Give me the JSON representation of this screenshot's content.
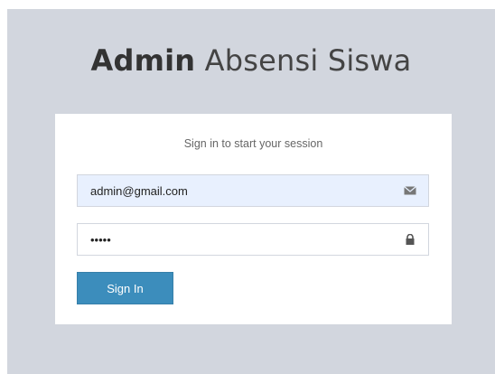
{
  "logo": {
    "bold": "Admin",
    "light": "Absensi Siswa"
  },
  "login": {
    "message": "Sign in to start your session",
    "email": {
      "value": "admin@gmail.com",
      "icon": "envelope-icon"
    },
    "password": {
      "value": "•••••",
      "icon": "lock-icon"
    },
    "submit_label": "Sign In"
  },
  "colors": {
    "background": "#d2d6de",
    "primary": "#3c8dbc",
    "autofill": "#e8f0fe"
  }
}
